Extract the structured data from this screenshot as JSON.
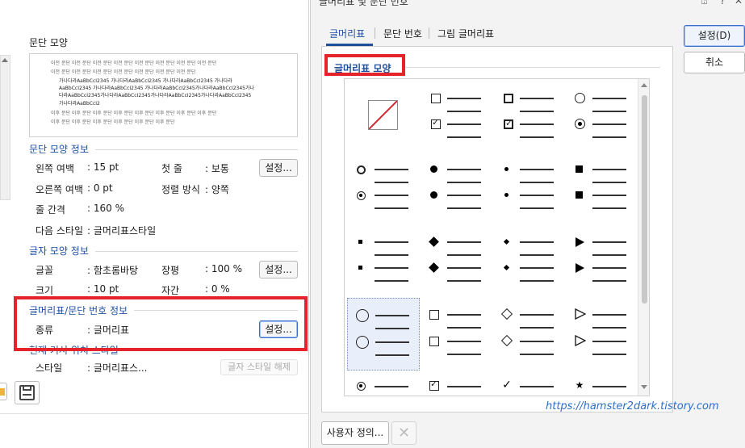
{
  "left": {
    "preview_title": "문단 모양",
    "preview_lines": [
      "이전 문단 이전 문단 이전 문단 이전 문단 이전 문단 이전 문단 이전 문단 이전 문단",
      "이전 문단 이전 문단 이전 문단 이전 문단 이전 문단 이전 문단 이전 문단",
      "가나다라AaBbCcI2345  가나다라AaBbCcI2345  가나다라AaBbCcI2345  가나다라",
      "AaBbCcI2345 가나다라AaBbCcI2345 가나다라AaBbCcI2345가나다라AaBbCcI2345가나",
      "다라AaBbCcI2345가나다라AaBbCcI2345가나다라AaBbCcI2345가나다라AaBbCcI2345",
      "가나다라AaBbCcI2",
      "이후 문단 이후 문단 이후 문단 이후 문단 이후 문단 이후 문단 이후 문단 이후 문단",
      "이후 문단 이후 문단 이후 문단 이후 문단 이후 문단 이후 문단"
    ],
    "para_info": {
      "title": "문단 모양 정보",
      "left_margin_label": "왼쪽 여백",
      "left_margin_value": ": 15 pt",
      "first_line_label": "첫 줄",
      "first_line_value": ": 보통",
      "right_margin_label": "오른쪽 여백",
      "right_margin_value": ": 0 pt",
      "align_label": "정렬 방식",
      "align_value": ": 양쪽",
      "line_spacing_label": "줄 간격",
      "line_spacing_value": ": 160 %",
      "next_style_label": "다음 스타일",
      "next_style_value": ": 글머리표스타일",
      "settings_button": "설정..."
    },
    "char_info": {
      "title": "글자 모양 정보",
      "font_label": "글꼴",
      "font_value": ": 함초롬바탕",
      "width_label": "장평",
      "width_value": ": 100 %",
      "size_label": "크기",
      "size_value": ": 10 pt",
      "spacing_label": "자간",
      "spacing_value": ": 0 %",
      "settings_button": "설정..."
    },
    "bullet_info": {
      "title": "글머리표/문단 번호 정보",
      "type_label": "종류",
      "type_value": ": 글머리표",
      "settings_button": "설정..."
    },
    "cursor_style": {
      "title": "현재 커서 위치 스타일",
      "style_label": "스타일",
      "style_value": ": 글머리표스...",
      "release_button": "글자 스타일 해제"
    }
  },
  "dialog": {
    "title": "글머리표 및 문단 번호",
    "tabs": [
      "글머리표",
      "문단 번호",
      "그림 글머리표"
    ],
    "group_title": "글머리표 모양",
    "ok_button": "설정(D)",
    "cancel_button": "취소",
    "custom_button": "사용자 정의...",
    "watermark": "https://hamster2dark.tistory.com",
    "bullets": [
      [
        "none",
        "checkbox",
        "checkbox-filled",
        "circle-radio"
      ],
      [
        "small-circle",
        "large-dot",
        "small-dot",
        "square"
      ],
      [
        "tiny-square",
        "diamond",
        "small-diamond",
        "triangle"
      ],
      [
        "large-circle",
        "empty-square",
        "empty-diamond",
        "empty-triangle"
      ],
      [
        "target",
        "check-box",
        "check",
        "star"
      ]
    ]
  },
  "chart_data": null
}
